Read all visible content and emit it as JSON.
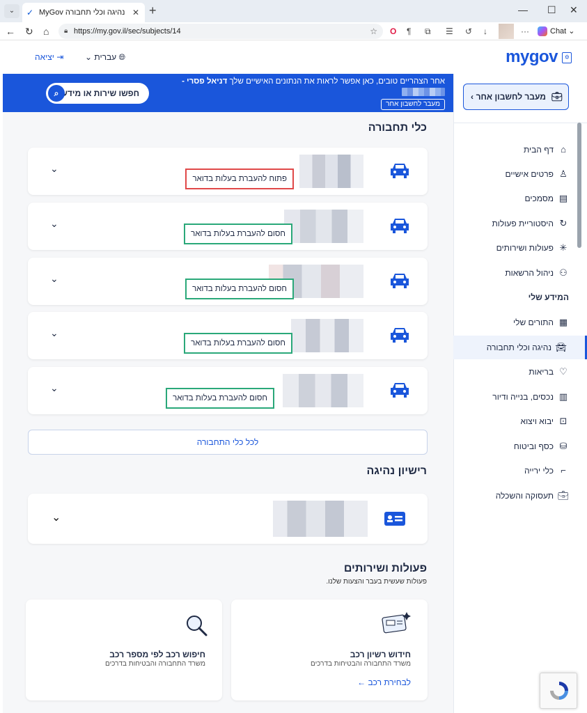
{
  "browser": {
    "tab_title": "MyGov נהיגה וכלי תחבורה",
    "url": "https://my.gov.il/sec/subjects/14",
    "chat_label": "Chat"
  },
  "header": {
    "logo_text": "mygov",
    "language_label": "עברית",
    "logout_label": "יציאה"
  },
  "sidebar": {
    "switch_account_label": "מעבר לחשבון אחר",
    "items": [
      {
        "label": "דף הבית",
        "icon": "home-icon"
      },
      {
        "label": "פרטים אישיים",
        "icon": "person-icon"
      },
      {
        "label": "מסמכים",
        "icon": "document-icon"
      },
      {
        "label": "היסטוריית פעולות",
        "icon": "history-icon"
      },
      {
        "label": "פעולות ושירותים",
        "icon": "sparkle-icon"
      },
      {
        "label": "ניהול הרשאות",
        "icon": "users-icon"
      }
    ],
    "section_title": "המידע שלי",
    "info_items": [
      {
        "label": "התורים שלי",
        "icon": "calendar-icon"
      },
      {
        "label": "נהיגה וכלי תחבורה",
        "icon": "car-icon",
        "active": true
      },
      {
        "label": "בריאות",
        "icon": "stethoscope-icon"
      },
      {
        "label": "נכסים, בנייה ודיור",
        "icon": "building-icon"
      },
      {
        "label": "יבוא ויצוא",
        "icon": "box-icon"
      },
      {
        "label": "כסף וביטוח",
        "icon": "coins-icon"
      },
      {
        "label": "כלי ירייה",
        "icon": "gun-icon"
      },
      {
        "label": "תעסוקה והשכלה",
        "icon": "briefcase-icon"
      }
    ]
  },
  "banner": {
    "greeting_prefix": "אחר הצהריים טובים,  כאן אפשר לראות את הנתונים האישיים שלך",
    "user_name": "דניאל פסרי -",
    "switch_account_label": "מעבר לחשבון אחר",
    "search_label": "חפשו שירות או מידע"
  },
  "vehicles": {
    "title": "כלי תחבורה",
    "items": [
      {
        "status": "פתוח להעברת בעלות בדואר",
        "state": "open"
      },
      {
        "status": "חסום להעברת בעלות בדואר",
        "state": "closed"
      },
      {
        "status": "חסום להעברת בעלות בדואר",
        "state": "closed"
      },
      {
        "status": "חסום להעברת בעלות בדואר",
        "state": "closed"
      },
      {
        "status": "חסום להעברת בעלות בדואר",
        "state": "closed"
      }
    ],
    "all_button_label": "לכל כלי התחבורה"
  },
  "license": {
    "title": "רישיון נהיגה"
  },
  "services": {
    "title": "פעולות ושירותים",
    "subtitle": "פעולות שעשית בעבר והצעות שלנו.",
    "cards": [
      {
        "title": "חידוש רשיון רכב",
        "subtitle": "משרד התחבורה והבטיחות בדרכים",
        "link": "לבחירת רכב"
      },
      {
        "title": "חיפוש רכב לפי מספר רכב",
        "subtitle": "משרד התחבורה והבטיחות בדרכים"
      }
    ]
  },
  "colors": {
    "accent": "#1a56db",
    "open_border": "#e04848",
    "closed_border": "#2aa879"
  }
}
